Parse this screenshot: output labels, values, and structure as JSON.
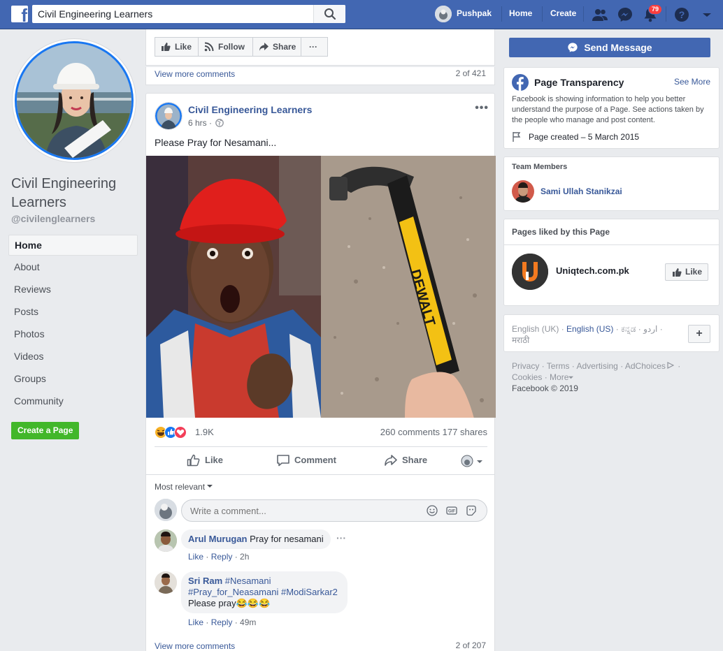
{
  "topbar": {
    "search_value": "Civil Engineering Learners",
    "user_name": "Pushpak",
    "home_label": "Home",
    "create_label": "Create",
    "notification_count": "79"
  },
  "left": {
    "page_name": "Civil Engineering Learners",
    "handle": "@civilenglearners",
    "nav": [
      "Home",
      "About",
      "Reviews",
      "Posts",
      "Photos",
      "Videos",
      "Groups",
      "Community"
    ],
    "create_page_label": "Create a Page"
  },
  "action_bar": {
    "like": "Like",
    "follow": "Follow",
    "share": "Share",
    "more": "···"
  },
  "prev_post": {
    "view_more": "View more comments",
    "count": "2 of 421"
  },
  "post": {
    "author": "Civil Engineering Learners",
    "time": "6 hrs ·",
    "text": "Please Pray for Nesamani...",
    "menu": "•••",
    "reaction_count": "1.9K",
    "comments_shares": "260 comments  177 shares",
    "like_label": "Like",
    "comment_label": "Comment",
    "share_label": "Share",
    "most_relevant": "Most relevant",
    "comment_placeholder": "Write a comment...",
    "comments": [
      {
        "name": "Arul Murugan",
        "text": "Pray for nesamani",
        "like": "Like",
        "reply": "Reply",
        "time": "2h"
      },
      {
        "name": "Sri Ram",
        "tag1": "#Nesamani",
        "tag2": "#Pray_for_Neasamani",
        "tag3": "#ModiSarkar2",
        "text": "Please pray😂😂😂",
        "like": "Like",
        "reply": "Reply",
        "time": "49m"
      }
    ],
    "view_more": "View more comments",
    "view_more_count": "2 of 207"
  },
  "right": {
    "send_message": "Send Message",
    "transparency": {
      "title": "Page Transparency",
      "see_more": "See More",
      "description": "Facebook is showing information to help you better understand the purpose of a Page. See actions taken by the people who manage and post content.",
      "created": "Page created – 5 March 2015"
    },
    "team": {
      "title": "Team Members",
      "member": "Sami Ullah Stanikzai"
    },
    "liked": {
      "title": "Pages liked by this Page",
      "page_name": "Uniqtech.com.pk",
      "like_label": "Like"
    },
    "languages": {
      "items": [
        "English (UK)",
        "English (US)",
        "ಕನ್ನಡ",
        "اردو",
        "मराठी"
      ],
      "add": "+"
    },
    "footer": {
      "links": [
        "Privacy",
        "Terms",
        "Advertising",
        "AdChoices",
        "Cookies",
        "More"
      ],
      "copyright": "Facebook © 2019"
    }
  },
  "colors": {
    "brand_blue": "#4267b2",
    "link_blue": "#385898",
    "green": "#42b72a",
    "badge_red": "#fa3e3e"
  }
}
